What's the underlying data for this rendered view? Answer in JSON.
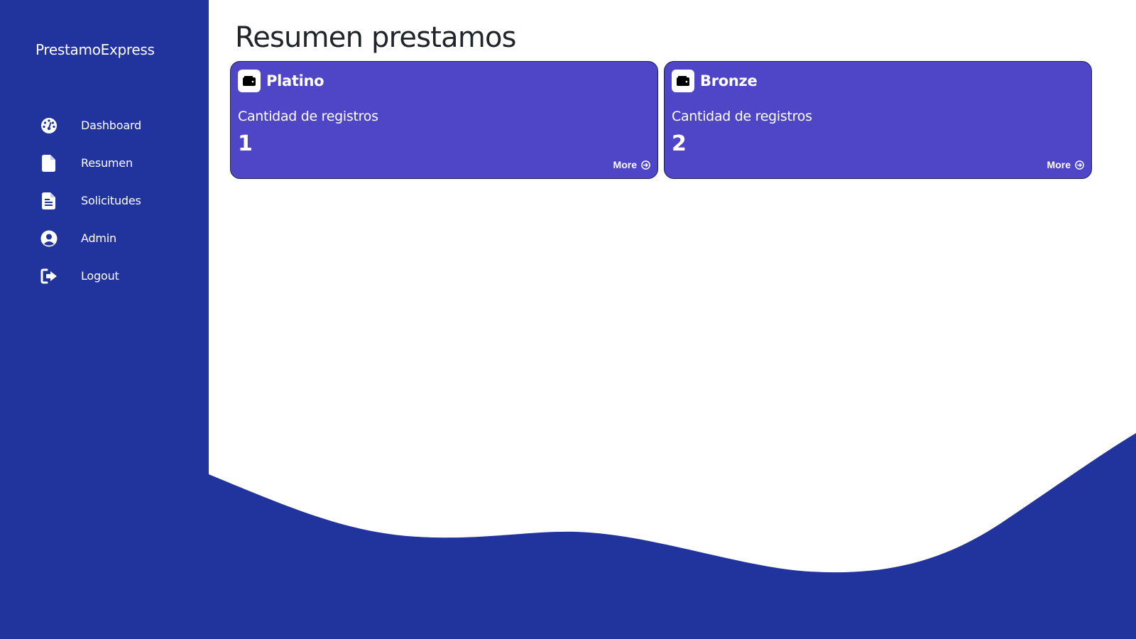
{
  "sidebar": {
    "brand": "PrestamoExpress",
    "items": [
      {
        "label": "Dashboard",
        "icon": "dashboard-gauge-icon"
      },
      {
        "label": "Resumen",
        "icon": "file-icon"
      },
      {
        "label": "Solicitudes",
        "icon": "file-lines-icon"
      },
      {
        "label": "Admin",
        "icon": "user-circle-icon"
      },
      {
        "label": "Logout",
        "icon": "logout-icon"
      }
    ]
  },
  "main": {
    "title": "Resumen prestamos",
    "cards": [
      {
        "title": "Platino",
        "subtitle": "Cantidad de registros",
        "count": "1",
        "more": "More",
        "icon": "wallet-icon"
      },
      {
        "title": "Bronze",
        "subtitle": "Cantidad de registros",
        "count": "2",
        "more": "More",
        "icon": "wallet-icon"
      }
    ]
  },
  "colors": {
    "sidebar": "#21339d",
    "card": "#4f46c7",
    "wave": "#21339d",
    "title_text": "#212529"
  }
}
